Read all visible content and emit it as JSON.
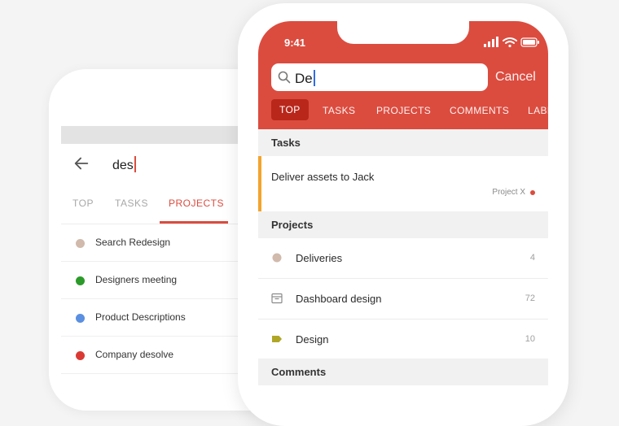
{
  "back_phone": {
    "search": {
      "query": "des"
    },
    "tabs": [
      {
        "label": "TOP",
        "active": false
      },
      {
        "label": "TASKS",
        "active": false
      },
      {
        "label": "PROJECTS",
        "active": true
      }
    ],
    "results": [
      {
        "label": "Search Redesign",
        "color": "#d1b9ac"
      },
      {
        "label": "Designers meeting",
        "color": "#2c9a2a"
      },
      {
        "label": "Product Descriptions",
        "color": "#5b8fe0"
      },
      {
        "label": "Company desolve",
        "color": "#db3a34"
      }
    ]
  },
  "front_phone": {
    "status_bar": {
      "time": "9:41"
    },
    "search": {
      "query": "De",
      "cancel_label": "Cancel"
    },
    "tabs": [
      {
        "label": "TOP",
        "active": true
      },
      {
        "label": "TASKS",
        "active": false
      },
      {
        "label": "PROJECTS",
        "active": false
      },
      {
        "label": "COMMENTS",
        "active": false
      },
      {
        "label": "LABE",
        "active": false
      }
    ],
    "sections": {
      "tasks_title": "Tasks",
      "projects_title": "Projects",
      "comments_title": "Comments"
    },
    "task": {
      "label": "Deliver assets to Jack",
      "project": "Project X",
      "accent_color": "#f2a42c"
    },
    "projects": [
      {
        "label": "Deliveries",
        "count": "4",
        "icon": "dot-icon",
        "color": "#d1b9ac"
      },
      {
        "label": "Dashboard design",
        "count": "72",
        "icon": "archive-icon",
        "color": "#8a8a8a"
      },
      {
        "label": "Design",
        "count": "10",
        "icon": "label-tag-icon",
        "color": "#b0a626"
      }
    ]
  },
  "colors": {
    "brand_red": "#db4c3f",
    "active_tab_bg": "#b9271b",
    "caret_blue": "#2f6de1"
  }
}
